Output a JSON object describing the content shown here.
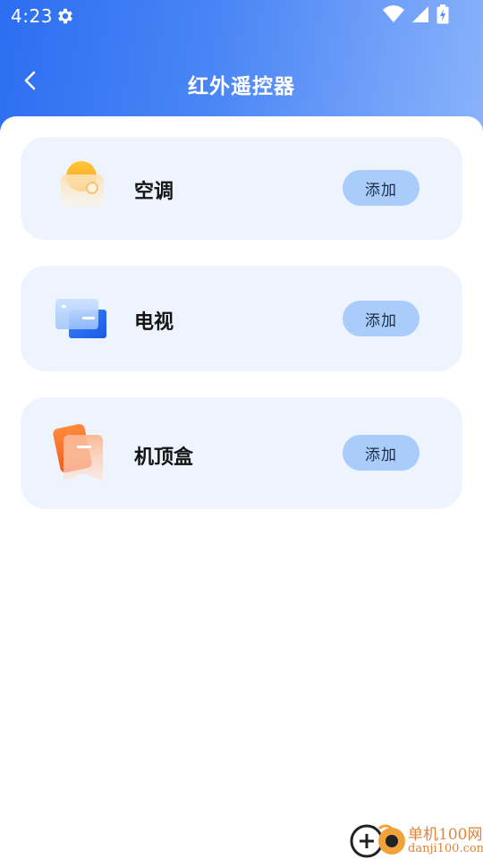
{
  "status_bar": {
    "time": "4:23",
    "icons": [
      "settings-gear-icon",
      "wifi-icon",
      "cellular-signal-icon",
      "battery-charging-icon"
    ]
  },
  "header": {
    "title": "红外遥控器",
    "back_icon": "chevron-left-icon",
    "colors": {
      "gradient_start": "#2c6ef2",
      "gradient_end": "#8ab2fb"
    }
  },
  "devices": [
    {
      "label": "空调",
      "icon": "air-conditioner-icon",
      "button": "添加"
    },
    {
      "label": "电视",
      "icon": "television-icon",
      "button": "添加"
    },
    {
      "label": "机顶盒",
      "icon": "set-top-box-icon",
      "button": "添加"
    }
  ],
  "watermark": {
    "line1": "单机100网",
    "line2": "danji100.com"
  },
  "colors": {
    "card_bg": "#eef4fe",
    "button_bg": "#a9ccfb"
  }
}
